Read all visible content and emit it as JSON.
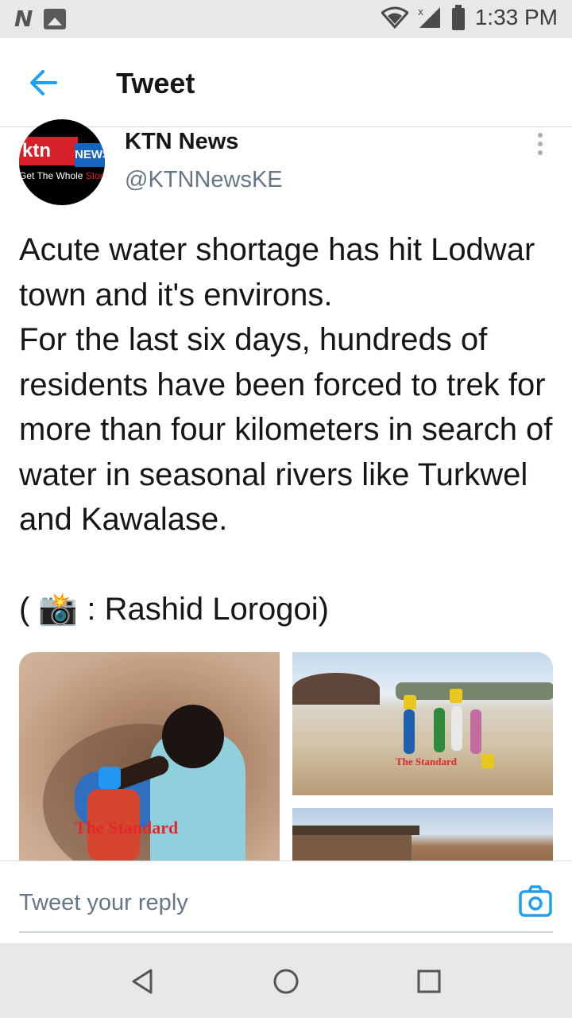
{
  "status_bar": {
    "time": "1:33 PM",
    "left_icons": [
      "n-notification-icon",
      "image-notification-icon"
    ],
    "right_icons": [
      "wifi-icon",
      "signal-icon",
      "battery-icon"
    ]
  },
  "header": {
    "title": "Tweet",
    "back_icon": "arrow-left-icon"
  },
  "tweet": {
    "author_name": "KTN News",
    "author_handle": "@KTNNewsKE",
    "avatar": {
      "logo_text": "ktn",
      "logo_badge": "NEWS",
      "slogan": "Get The Whole ",
      "slogan_accent": "Story"
    },
    "text": "Acute water shortage has hit Lodwar town and it's environs.\nFor the last six days, hundreds of residents have been forced to trek for more than four kilometers in search of water in seasonal rivers like Turkwel and Kawalase.\n\n( 📸 : Rashid Lorogoi)",
    "media": {
      "photo_1_watermark": "The Standard",
      "photo_2_watermark": "The Standard"
    }
  },
  "reply": {
    "placeholder": "Tweet your reply",
    "camera_icon": "camera-icon"
  },
  "nav_bar": {
    "icons": [
      "back-triangle-icon",
      "home-circle-icon",
      "recents-square-icon"
    ]
  },
  "colors": {
    "accent": "#1da1f2",
    "text_primary": "#14171a",
    "text_secondary": "#657786",
    "system_bar": "#e8e8e8"
  }
}
